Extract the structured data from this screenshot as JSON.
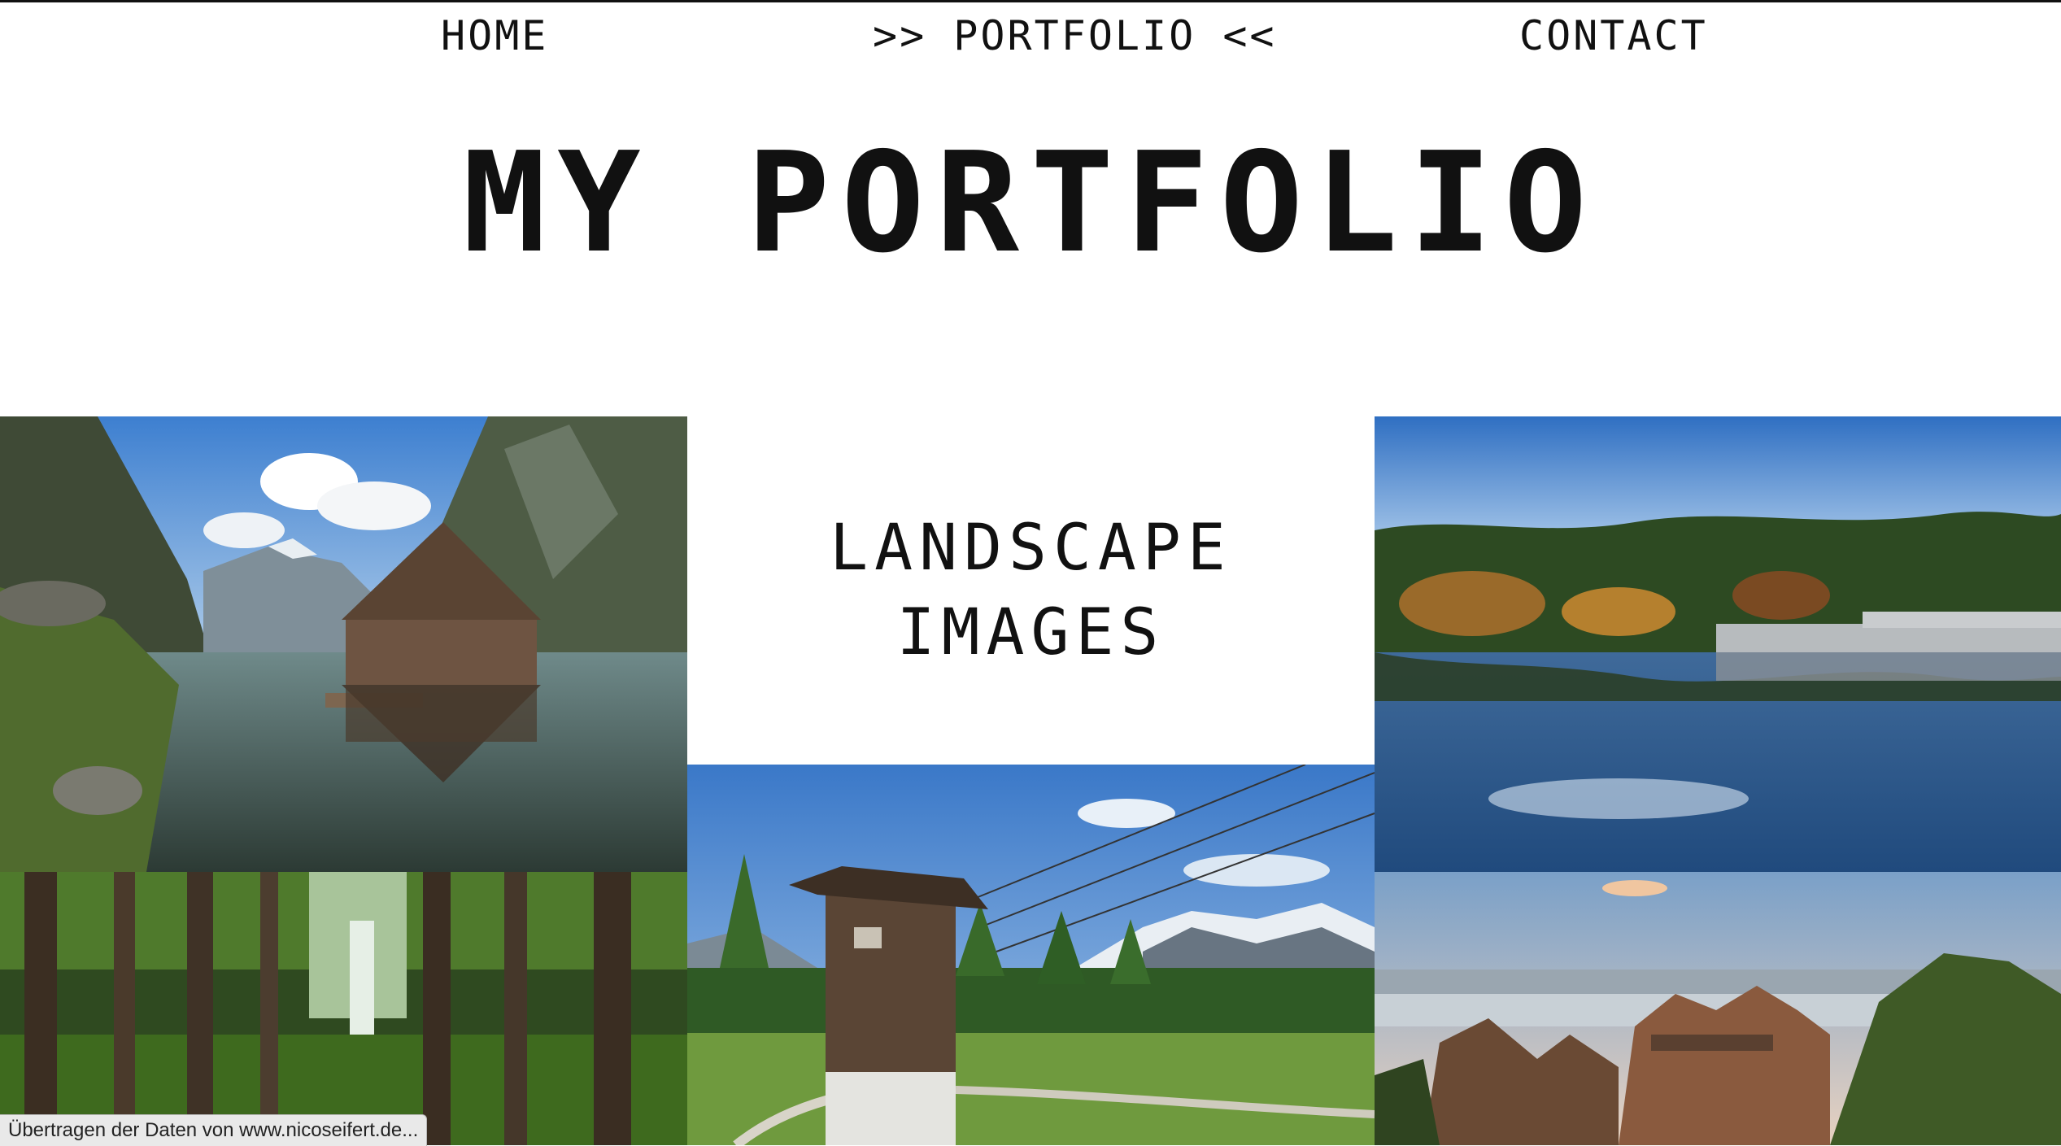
{
  "nav": {
    "home": "HOME",
    "portfolio": ">> PORTFOLIO <<",
    "contact": "CONTACT"
  },
  "page_title": "MY PORTFOLIO",
  "category": {
    "line1": "LANDSCAPE",
    "line2": "IMAGES"
  },
  "status_bar": "Übertragen der Daten von www.nicoseifert.de...",
  "colors": {
    "text": "#111111",
    "background": "#ffffff"
  }
}
